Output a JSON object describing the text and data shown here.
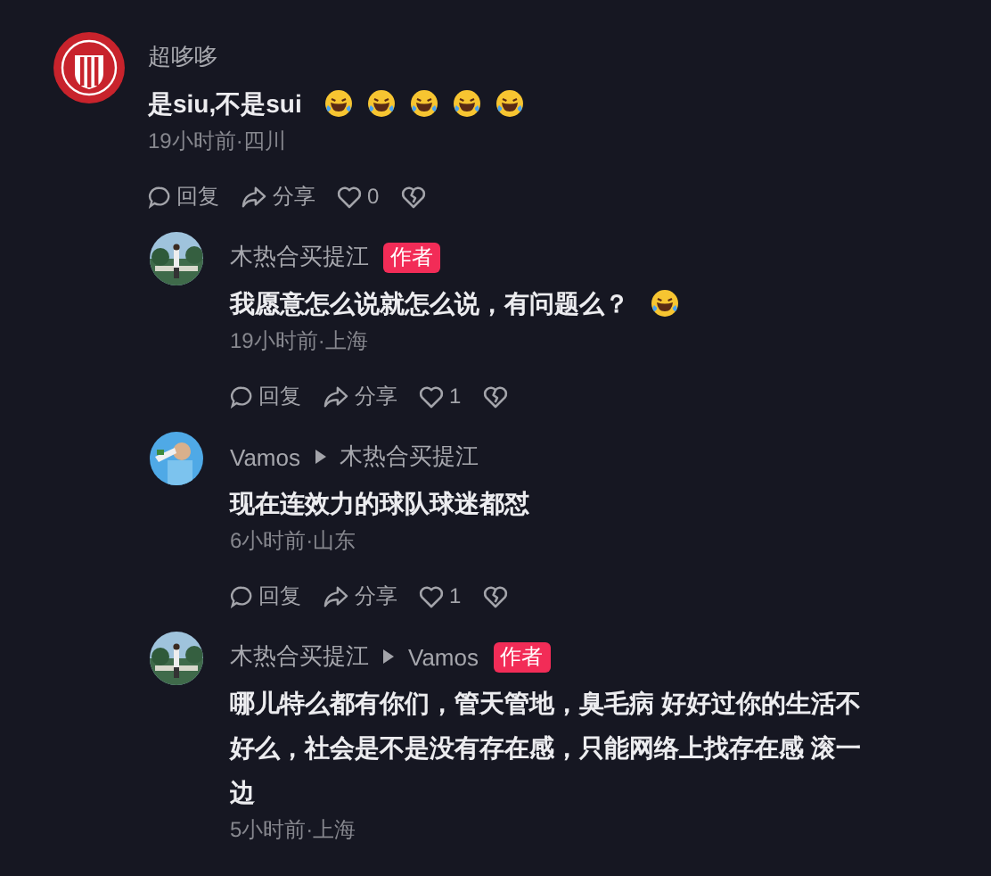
{
  "comment": {
    "avatar": {
      "kind": "club-crest"
    },
    "author": "超哆哆",
    "text": "是siu,不是sui",
    "emojis": [
      {
        "kind": "laughing-crying"
      },
      {
        "kind": "laughing-crying"
      },
      {
        "kind": "laughing-crying"
      },
      {
        "kind": "laughing-crying"
      },
      {
        "kind": "laughing-crying"
      }
    ],
    "meta": "19小时前·四川",
    "actions": {
      "reply": "回复",
      "share": "分享",
      "likes": "0"
    }
  },
  "replies": [
    {
      "avatar": {
        "kind": "person-landscape"
      },
      "author": "木热合买提江",
      "badge": "作者",
      "text": "我愿意怎么说就怎么说，有问题么？",
      "emojis": [
        {
          "kind": "laughing-crying"
        }
      ],
      "meta": "19小时前·上海",
      "actions": {
        "reply": "回复",
        "share": "分享",
        "likes": "1"
      }
    },
    {
      "avatar": {
        "kind": "person-sky"
      },
      "author": "Vamos",
      "reply_to": "木热合买提江",
      "text": "现在连效力的球队球迷都怼",
      "meta": "6小时前·山东",
      "actions": {
        "reply": "回复",
        "share": "分享",
        "likes": "1"
      }
    },
    {
      "avatar": {
        "kind": "person-landscape"
      },
      "author": "木热合买提江",
      "reply_to": "Vamos",
      "badge": "作者",
      "text": "哪儿特么都有你们，管天管地，臭毛病 好好过你的生活不好么，社会是不是没有存在感，只能网络上找存在感 滚一边",
      "meta": "5小时前·上海"
    }
  ]
}
